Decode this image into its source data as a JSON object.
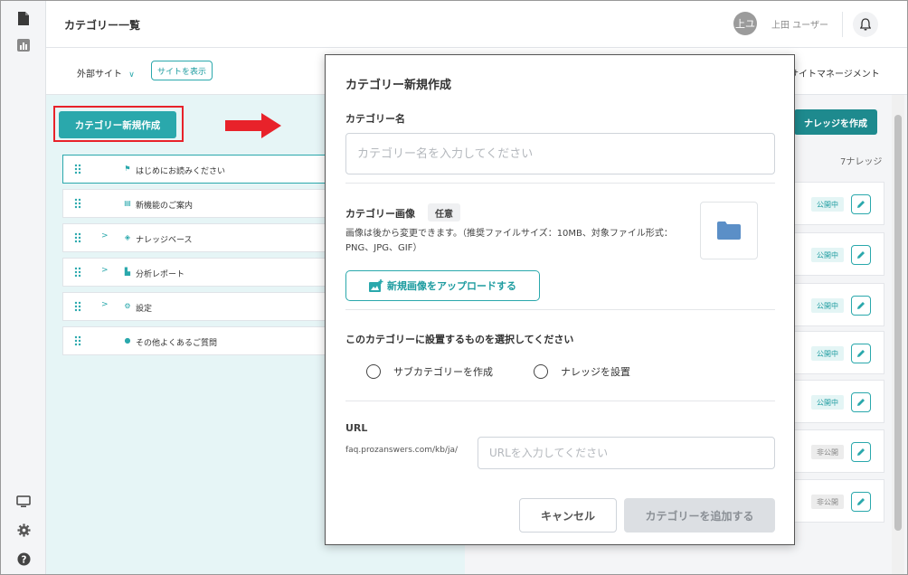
{
  "header": {
    "title": "カテゴリー一覧",
    "avatar_initials": "上ユ",
    "user_name": "上田 ユーザー"
  },
  "subbar": {
    "site_selector": "外部サイト",
    "view_site": "サイトを表示",
    "site_management": "サイトマネージメント"
  },
  "categories": {
    "new_button": "カテゴリー新規作成",
    "items": [
      {
        "label": "はじめにお読みください",
        "icon": "flag-icon",
        "has_children": false
      },
      {
        "label": "新機能のご案内",
        "icon": "news-icon",
        "has_children": false
      },
      {
        "label": "ナレッジベース",
        "icon": "layers-icon",
        "has_children": true
      },
      {
        "label": "分析レポート",
        "icon": "chart-icon",
        "has_children": true
      },
      {
        "label": "設定",
        "icon": "gear-icon",
        "has_children": true
      },
      {
        "label": "その他よくあるご質問",
        "icon": "question-icon",
        "has_children": false
      }
    ]
  },
  "knowledge": {
    "create_button": "ナレッジを作成",
    "count": "7ナレッジ",
    "statuses": [
      "公開中",
      "公開中",
      "公開中",
      "公開中",
      "公開中",
      "非公開",
      "非公開"
    ]
  },
  "modal": {
    "title": "カテゴリー新規作成",
    "name_label": "カテゴリー名",
    "name_placeholder": "カテゴリー名を入力してください",
    "image_label": "カテゴリー画像",
    "optional": "任意",
    "image_desc": "画像は後から変更できます。（推奨ファイルサイズ：10MB、対象ファイル形式：PNG、JPG、GIF）",
    "upload_button": "新規画像をアップロードする",
    "select_label": "このカテゴリーに設置するものを選択してください",
    "option_sub": "サブカテゴリーを作成",
    "option_knowledge": "ナレッジを設置",
    "url_label": "URL",
    "url_prefix": "faq.prozanswers.com/kb/ja/",
    "url_placeholder": "URLを入力してください",
    "cancel": "キャンセル",
    "add": "カテゴリーを追加する"
  },
  "colors": {
    "accent": "#2aa8ac",
    "highlight": "#e8222a"
  }
}
